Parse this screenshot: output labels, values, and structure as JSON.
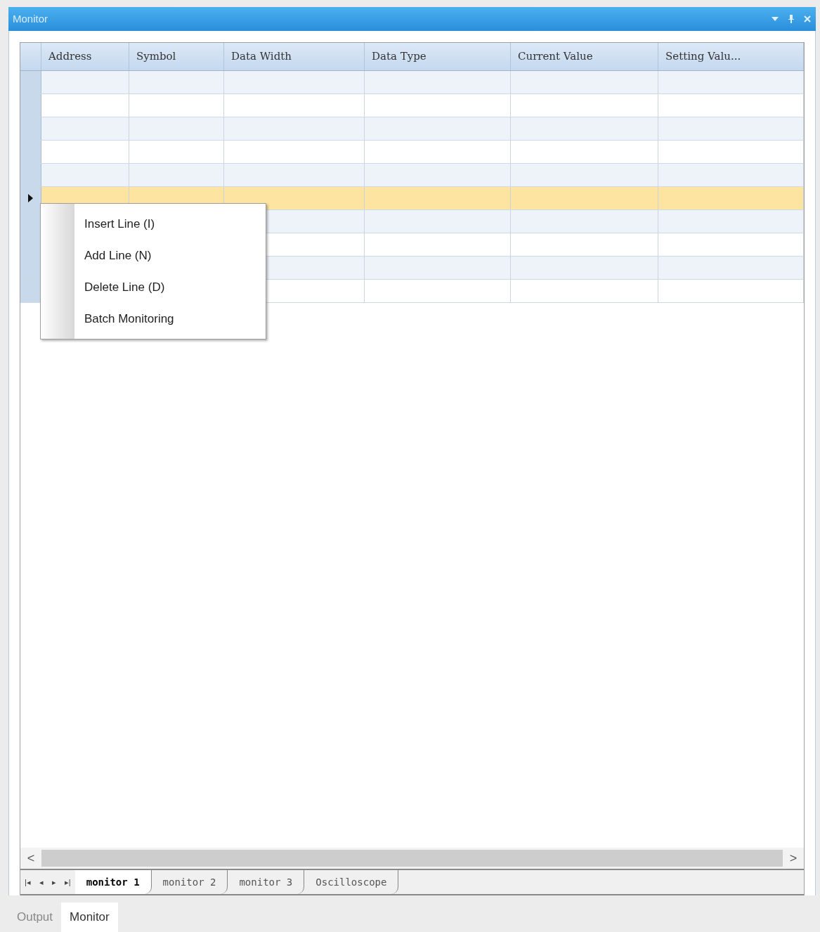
{
  "window": {
    "title": "Monitor"
  },
  "table": {
    "columns": [
      "Address",
      "Symbol",
      "Data Width",
      "Data Type",
      "Current Value",
      "Setting Valu..."
    ],
    "rows": [
      {
        "selected": false
      },
      {
        "selected": false
      },
      {
        "selected": false
      },
      {
        "selected": false
      },
      {
        "selected": false
      },
      {
        "selected": true
      },
      {
        "selected": false
      },
      {
        "selected": false
      },
      {
        "selected": false
      },
      {
        "selected": false
      }
    ]
  },
  "context_menu": {
    "items": [
      "Insert Line (I)",
      "Add Line (N)",
      "Delete Line (D)",
      "Batch Monitoring"
    ]
  },
  "scroll_bar": {
    "left": "<",
    "right": ">"
  },
  "sheet_nav": [
    "|◂",
    "◂",
    "▸",
    "▸|"
  ],
  "sheet_tabs": [
    {
      "label": "monitor 1",
      "selected": true
    },
    {
      "label": "monitor 2",
      "selected": false
    },
    {
      "label": "monitor 3",
      "selected": false
    },
    {
      "label": "Oscilloscope",
      "selected": false
    }
  ],
  "bottom_tabs": [
    {
      "label": "Output",
      "selected": false
    },
    {
      "label": "Monitor",
      "selected": true
    }
  ]
}
